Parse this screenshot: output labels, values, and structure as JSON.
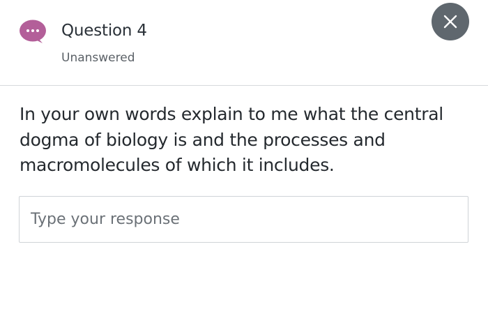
{
  "header": {
    "avatar_icon": "speech-bubble-ellipsis-icon",
    "avatar_color": "#b35f99",
    "question_title": "Question 4",
    "status": "Unanswered",
    "close_icon": "close-icon",
    "close_bg_color": "#5f676e"
  },
  "question": {
    "prompt": "In your own words explain to me what the central dogma of biology is and the processes and macromolecules of which it includes."
  },
  "response": {
    "value": "",
    "placeholder": "Type your response"
  }
}
